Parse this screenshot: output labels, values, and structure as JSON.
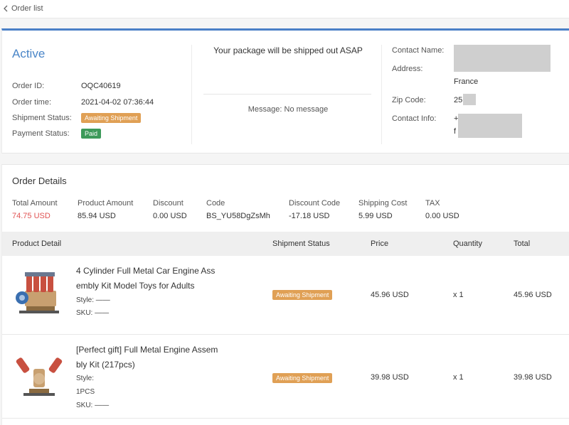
{
  "topbar": {
    "back_label": "Order list"
  },
  "order": {
    "status_title": "Active",
    "labels": {
      "order_id": "Order ID:",
      "order_time": "Order time:",
      "shipment_status": "Shipment Status:",
      "payment_status": "Payment Status:"
    },
    "order_id": "OQC40619",
    "order_time": "2021-04-02 07:36:44",
    "shipment_status": "Awaiting Shipment",
    "payment_status": "Paid"
  },
  "shipping": {
    "headline": "Your package will be shipped out ASAP",
    "message": "Message: No message"
  },
  "contact": {
    "labels": {
      "name": "Contact Name:",
      "address": "Address:",
      "zip": "Zip Code:",
      "info": "Contact Info:"
    },
    "country": "France",
    "zip_visible": "25",
    "info_visible_line1": "+",
    "info_visible_line2": "f"
  },
  "details": {
    "title": "Order Details",
    "summary": [
      {
        "label": "Total Amount",
        "value": "74.75 USD",
        "highlight": true
      },
      {
        "label": "Product Amount",
        "value": "85.94 USD"
      },
      {
        "label": "Discount",
        "value": "0.00 USD"
      },
      {
        "label": "Code",
        "value": "BS_YU58DgZsMh"
      },
      {
        "label": "Discount Code",
        "value": "-17.18 USD"
      },
      {
        "label": "Shipping Cost",
        "value": "5.99 USD"
      },
      {
        "label": "TAX",
        "value": "0.00 USD"
      }
    ],
    "table_headers": {
      "product": "Product Detail",
      "shipment": "Shipment Status",
      "price": "Price",
      "quantity": "Quantity",
      "total": "Total"
    },
    "items": [
      {
        "name": "4 Cylinder Full Metal Car Engine Assembly Kit Model Toys for Adults",
        "style": "Style: ——",
        "style_value": "",
        "sku": "SKU: ——",
        "shipment_status": "Awaiting Shipment",
        "price": "45.96 USD",
        "quantity": "x 1",
        "total": "45.96 USD"
      },
      {
        "name": "[Perfect gift] Full Metal Engine Assembly Kit (217pcs)",
        "style": "Style:",
        "style_value": "1PCS",
        "sku": "SKU: ——",
        "shipment_status": "Awaiting Shipment",
        "price": "39.98 USD",
        "quantity": "x 1",
        "total": "39.98 USD"
      }
    ]
  },
  "colors": {
    "accent_blue": "#4a7fc6",
    "status_orange": "#e0a055",
    "paid_green": "#3d9a5a",
    "total_red": "#e05353"
  }
}
